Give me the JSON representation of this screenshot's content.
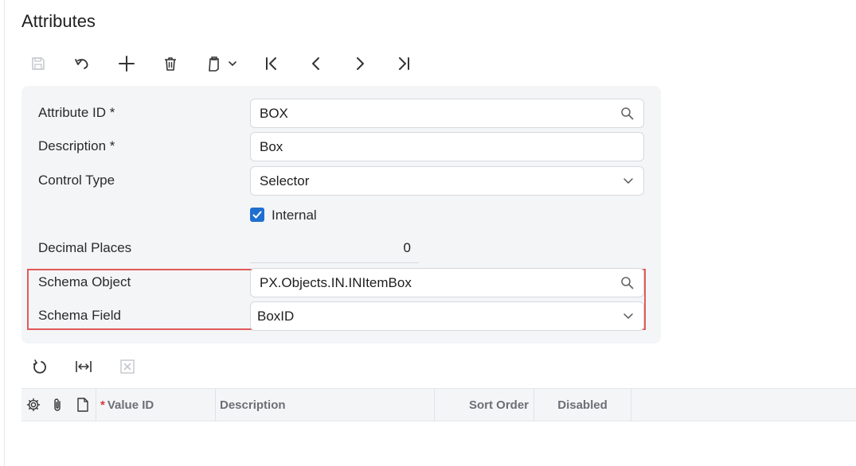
{
  "page": {
    "title": "Attributes"
  },
  "toolbar": {
    "buttons": [
      "save-icon",
      "undo-icon",
      "add-icon",
      "delete-icon",
      "copy-paste-icon",
      "first-icon",
      "previous-icon",
      "next-icon",
      "last-icon"
    ]
  },
  "form": {
    "attribute_id": {
      "label": "Attribute ID *",
      "value": "BOX"
    },
    "description": {
      "label": "Description *",
      "value": "Box"
    },
    "control_type": {
      "label": "Control Type",
      "value": "Selector"
    },
    "internal": {
      "label": "Internal",
      "checked": true
    },
    "decimal_places": {
      "label": "Decimal Places",
      "value": "0"
    },
    "schema_object": {
      "label": "Schema Object",
      "value": "PX.Objects.IN.INItemBox"
    },
    "schema_field": {
      "label": "Schema Field",
      "value": "BoxID"
    }
  },
  "grid": {
    "toolbar": [
      "refresh-icon",
      "fit-columns-icon",
      "excel-export-icon"
    ],
    "columns": {
      "value_id": {
        "required_mark": "*",
        "label": "Value ID"
      },
      "description": "Description",
      "sort_order": "Sort Order",
      "disabled": "Disabled"
    }
  },
  "colors": {
    "accent": "#1f6fd1",
    "highlight_border": "#e05a5a",
    "panel_bg": "#f4f5f7"
  }
}
